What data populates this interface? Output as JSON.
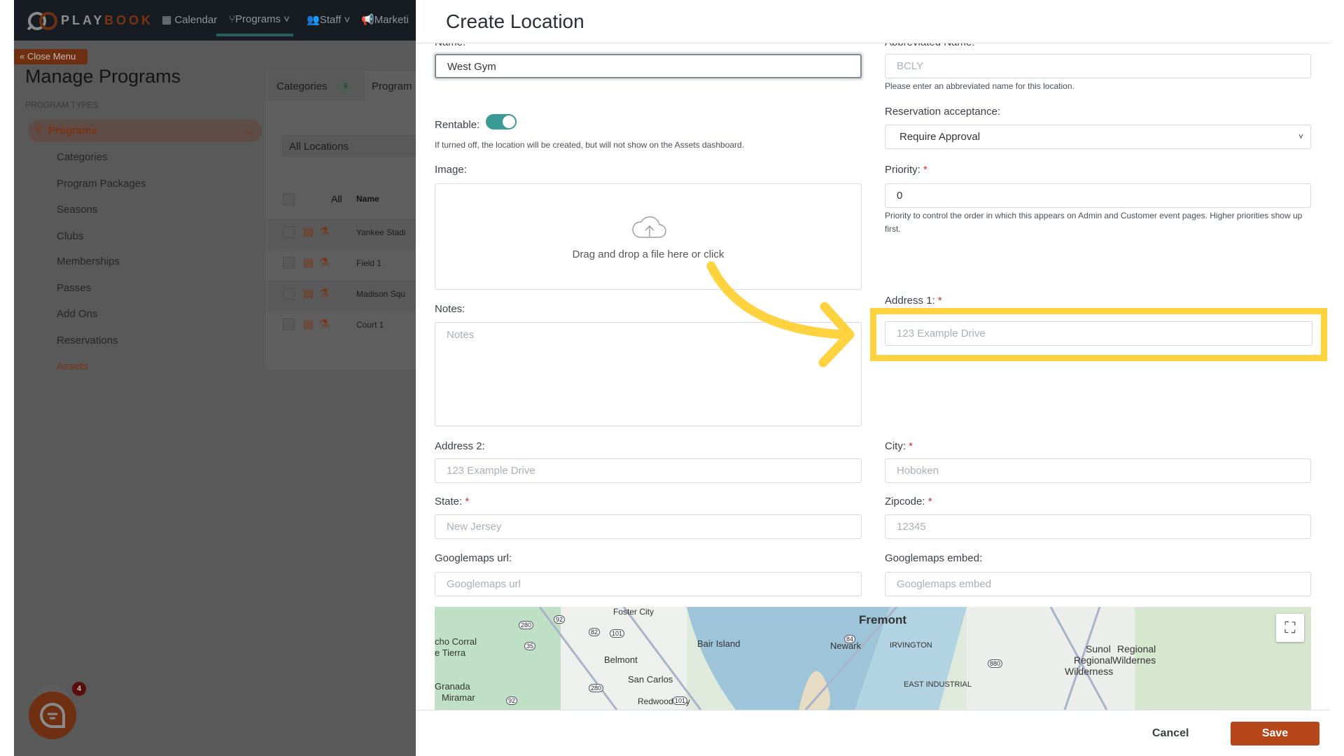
{
  "nav": {
    "logo_text_a": "PLAY",
    "logo_text_b": "BOOK",
    "items": [
      {
        "label": "Calendar",
        "icon": "calendar-icon"
      },
      {
        "label": "Programs",
        "icon": "branch-icon",
        "active": true
      },
      {
        "label": "Staff",
        "icon": "users-icon"
      },
      {
        "label": "Marketi",
        "icon": "megaphone-icon"
      }
    ]
  },
  "sidebar": {
    "close_menu": "Close Menu",
    "title": "Manage Programs",
    "section": "PROGRAM TYPES",
    "group": "Programs",
    "items": [
      "Categories",
      "Program Packages",
      "Seasons",
      "Clubs",
      "Memberships",
      "Passes",
      "Add Ons",
      "Reservations",
      "Assets"
    ],
    "active_item": "Assets"
  },
  "panel": {
    "tabs": [
      {
        "label": "Categories",
        "badge": "6"
      },
      {
        "label": "Program"
      }
    ],
    "location_filter": "All Locations",
    "table": {
      "headers": [
        "All",
        "Name"
      ],
      "rows": [
        "Yankee Stadi",
        "Field 1",
        "Madison Squ",
        "Court 1"
      ]
    }
  },
  "chat": {
    "badge": "4"
  },
  "modal": {
    "title": "Create Location",
    "name": {
      "label": "Name:",
      "value": "West Gym"
    },
    "abbr": {
      "label": "Abbreviated Name:",
      "placeholder": "BCLY",
      "help": "Please enter an abbreviated name for this location."
    },
    "rentable": {
      "label": "Rentable:",
      "on": true,
      "help": "If turned off, the location will be created, but will not show on the Assets dashboard."
    },
    "reservation": {
      "label": "Reservation acceptance:",
      "value": "Require Approval"
    },
    "image": {
      "label": "Image:",
      "drop_text": "Drag and drop a file here or click"
    },
    "priority": {
      "label": "Priority:",
      "value": "0",
      "help": "Priority to control the order in which this appears on Admin and Customer event pages. Higher priorities show up first."
    },
    "notes": {
      "label": "Notes:",
      "placeholder": "Notes"
    },
    "address1": {
      "label": "Address 1:",
      "placeholder": "123 Example Drive"
    },
    "address2": {
      "label": "Address 2:",
      "placeholder": "123 Example Drive"
    },
    "city": {
      "label": "City:",
      "placeholder": "Hoboken"
    },
    "state": {
      "label": "State:",
      "placeholder": "New Jersey"
    },
    "zipcode": {
      "label": "Zipcode:",
      "placeholder": "12345"
    },
    "gmaps_url": {
      "label": "Googlemaps url:",
      "placeholder": "Googlemaps url"
    },
    "gmaps_embed": {
      "label": "Googlemaps embed:",
      "placeholder": "Googlemaps embed"
    },
    "required_mark": "*",
    "map": {
      "labels": [
        "Foster City",
        "Bair Island",
        "Belmont",
        "San Carlos",
        "Redwood City",
        "Granada",
        "Miramar",
        "cho Corral",
        "e Tierra",
        "Fremont",
        "Newark",
        "IRVINGTON",
        "EAST INDUSTRIAL",
        "Sunol",
        "Regional",
        "Wilderness",
        "Regional",
        "Wildernes"
      ],
      "shields": [
        "280",
        "92",
        "82",
        "101",
        "35",
        "84",
        "880",
        "280",
        "92",
        "101"
      ]
    },
    "cancel": "Cancel",
    "save": "Save"
  },
  "colors": {
    "accent": "#b5471a",
    "highlight": "#ffd23f",
    "toggle": "#3a9a94"
  }
}
